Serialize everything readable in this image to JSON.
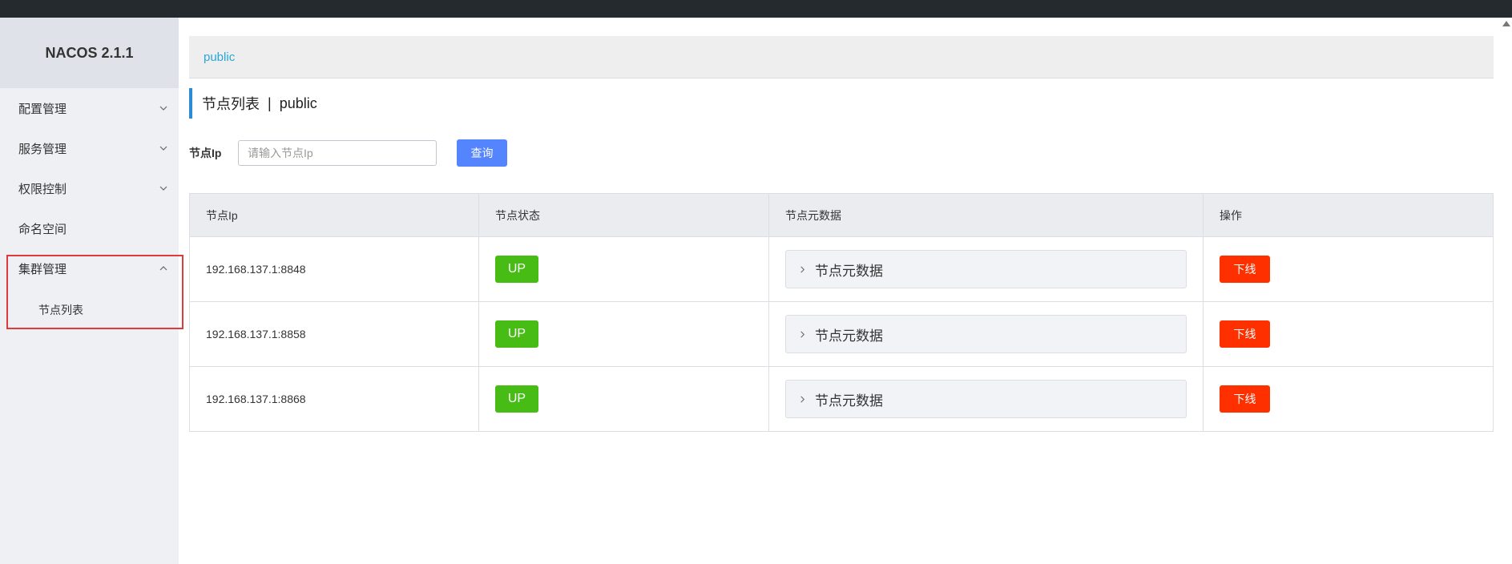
{
  "app": {
    "title": "NACOS 2.1.1"
  },
  "sidebar": {
    "items": [
      {
        "label": "配置管理",
        "icon": "chevron-down-icon"
      },
      {
        "label": "服务管理",
        "icon": "chevron-down-icon"
      },
      {
        "label": "权限控制",
        "icon": "chevron-down-icon"
      },
      {
        "label": "命名空间"
      },
      {
        "label": "集群管理",
        "icon": "chevron-up-icon",
        "expanded": true,
        "children": [
          {
            "label": "节点列表"
          }
        ]
      }
    ]
  },
  "namespace_bar": {
    "label": "public"
  },
  "page": {
    "title": "节点列表",
    "separator": "|",
    "namespace": "public"
  },
  "search": {
    "label": "节点Ip",
    "placeholder": "请输入节点Ip",
    "value": "",
    "button": "查询"
  },
  "table": {
    "headers": [
      "节点Ip",
      "节点状态",
      "节点元数据",
      "操作"
    ],
    "rows": [
      {
        "ip": "192.168.137.1:8848",
        "status": "UP",
        "metadata": "节点元数据",
        "action": "下线"
      },
      {
        "ip": "192.168.137.1:8858",
        "status": "UP",
        "metadata": "节点元数据",
        "action": "下线"
      },
      {
        "ip": "192.168.137.1:8868",
        "status": "UP",
        "metadata": "节点元数据",
        "action": "下线"
      }
    ]
  },
  "colors": {
    "status_up": "#46bc15",
    "offline_button": "#ff3000",
    "query_button": "#5584ff",
    "namespace_link": "#2aa6d6",
    "highlight_border": "#e03b3b"
  }
}
